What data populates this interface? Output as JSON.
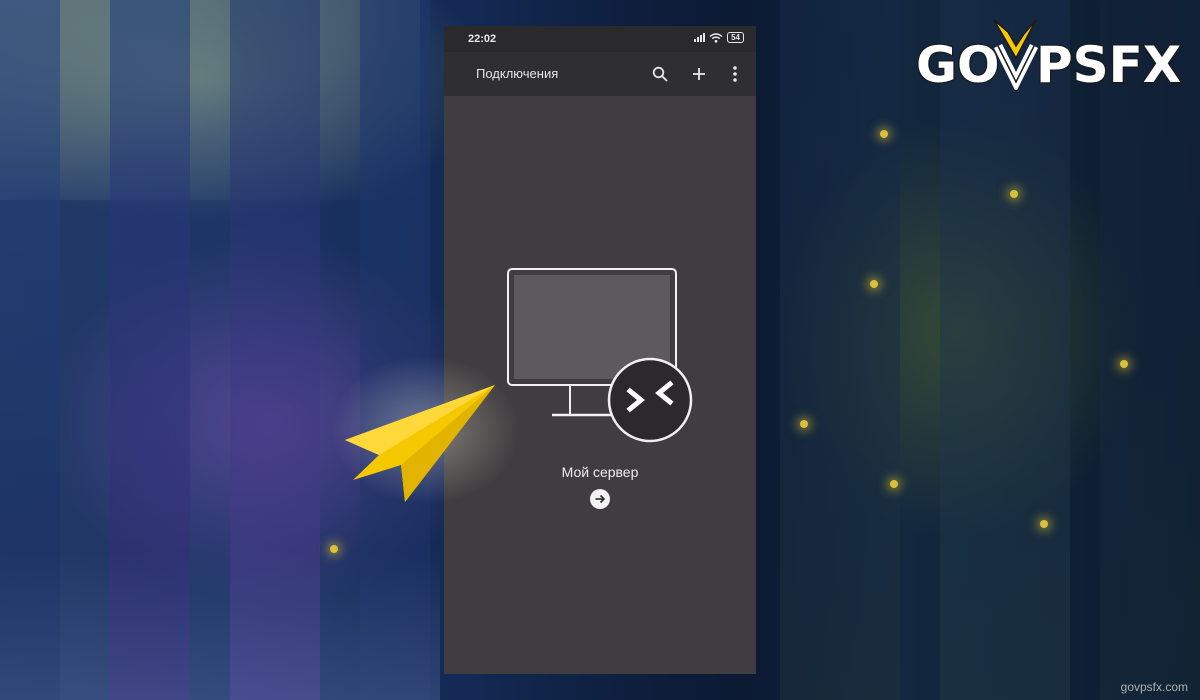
{
  "status_bar": {
    "time": "22:02",
    "battery": "54",
    "icons": [
      "signal-icon",
      "wifi-icon",
      "battery-icon"
    ]
  },
  "app_bar": {
    "title": "Подключения",
    "actions": [
      "search-icon",
      "plus-icon",
      "more-vert-icon"
    ]
  },
  "connection": {
    "name": "Мой сервер",
    "icon": "remote-desktop-monitor-icon",
    "action_icon": "arrow-right-icon"
  },
  "branding": {
    "logo_text": "GOVPSFX",
    "watermark": "govpsfx.com"
  },
  "colors": {
    "phone_background": "#403d40",
    "app_bar": "#2f2e30",
    "status_bar": "#2a2a2c",
    "pointer_arrow": "#f5c800"
  }
}
